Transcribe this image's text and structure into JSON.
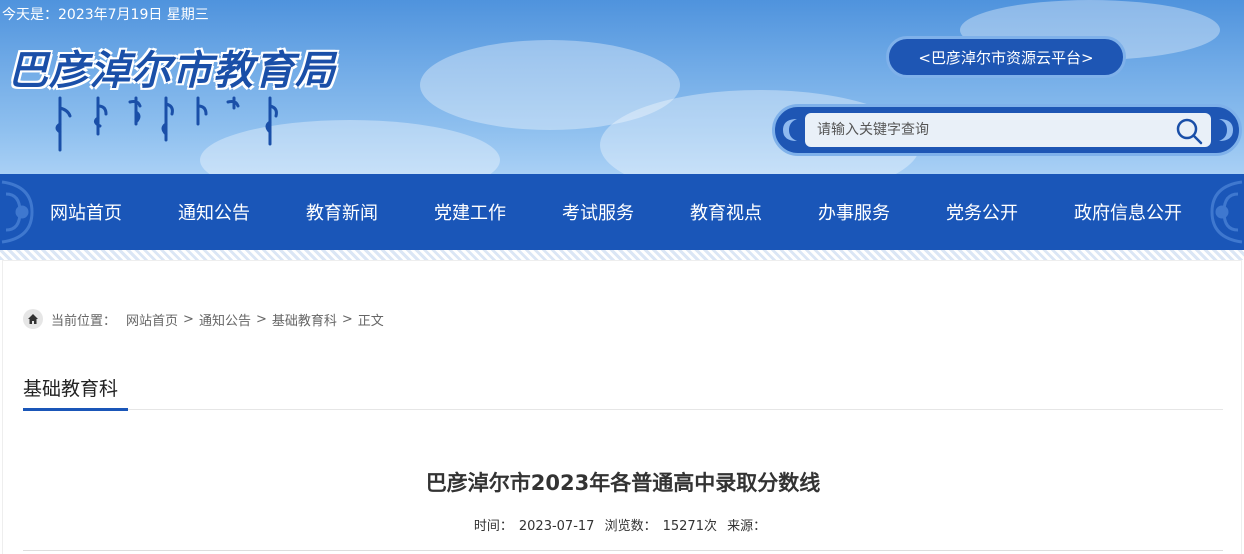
{
  "header": {
    "date_text": "今天是：2023年7月19日 星期三",
    "site_title": "巴彦淖尔市教育局",
    "platform_link": "<巴彦淖尔市资源云平台>",
    "search": {
      "placeholder": "请输入关键字查询"
    }
  },
  "nav": {
    "items": [
      "网站首页",
      "通知公告",
      "教育新闻",
      "党建工作",
      "考试服务",
      "教育视点",
      "办事服务",
      "党务公开",
      "政府信息公开"
    ]
  },
  "breadcrumb": {
    "label": "当前位置：",
    "items": [
      "网站首页",
      "通知公告",
      "基础教育科",
      "正文"
    ],
    "separator": ">"
  },
  "section": {
    "title": "基础教育科"
  },
  "article": {
    "title": "巴彦淖尔市2023年各普通高中录取分数线",
    "time_label": "时间：",
    "time_value": "2023-07-17",
    "views_label": "浏览数：",
    "views_value": "15271次",
    "source_label": "来源：",
    "source_value": ""
  },
  "colors": {
    "primary": "#1a56b8",
    "header_sky": "#6ea9e6"
  }
}
